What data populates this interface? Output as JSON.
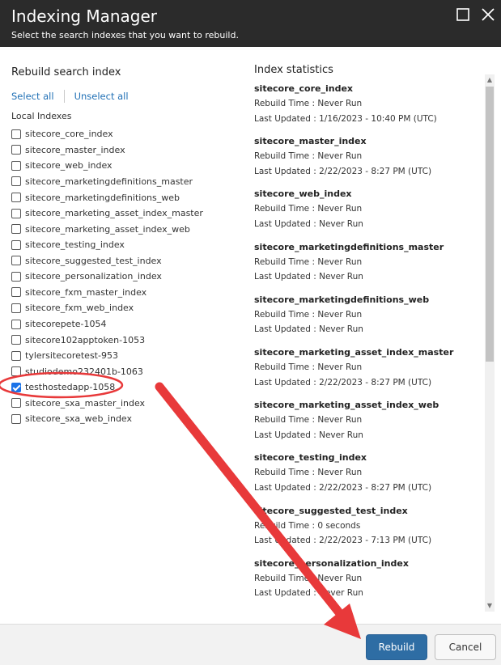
{
  "dialog": {
    "title": "Indexing Manager",
    "subtitle": "Select the search indexes that you want to rebuild."
  },
  "window_controls": {
    "maximize_icon": "maximize-icon",
    "close_icon": "close-icon"
  },
  "rebuild_panel": {
    "heading": "Rebuild search index",
    "select_all": "Select all",
    "unselect_all": "Unselect all",
    "group_label": "Local Indexes",
    "items": [
      {
        "label": "sitecore_core_index",
        "checked": false
      },
      {
        "label": "sitecore_master_index",
        "checked": false
      },
      {
        "label": "sitecore_web_index",
        "checked": false
      },
      {
        "label": "sitecore_marketingdefinitions_master",
        "checked": false
      },
      {
        "label": "sitecore_marketingdefinitions_web",
        "checked": false
      },
      {
        "label": "sitecore_marketing_asset_index_master",
        "checked": false
      },
      {
        "label": "sitecore_marketing_asset_index_web",
        "checked": false
      },
      {
        "label": "sitecore_testing_index",
        "checked": false
      },
      {
        "label": "sitecore_suggested_test_index",
        "checked": false
      },
      {
        "label": "sitecore_personalization_index",
        "checked": false
      },
      {
        "label": "sitecore_fxm_master_index",
        "checked": false
      },
      {
        "label": "sitecore_fxm_web_index",
        "checked": false
      },
      {
        "label": "sitecorepete-1054",
        "checked": false
      },
      {
        "label": "sitecore102apptoken-1053",
        "checked": false
      },
      {
        "label": "tylersitecoretest-953",
        "checked": false
      },
      {
        "label": "studiodemo232401b-1063",
        "checked": false
      },
      {
        "label": "testhostedapp-1058",
        "checked": true
      },
      {
        "label": "sitecore_sxa_master_index",
        "checked": false
      },
      {
        "label": "sitecore_sxa_web_index",
        "checked": false
      }
    ]
  },
  "stats_panel": {
    "heading": "Index statistics",
    "items": [
      {
        "name": "sitecore_core_index",
        "rebuild_time": "Rebuild Time : Never Run",
        "last_updated": "Last Updated : 1/16/2023 - 10:40 PM (UTC)"
      },
      {
        "name": "sitecore_master_index",
        "rebuild_time": "Rebuild Time : Never Run",
        "last_updated": "Last Updated : 2/22/2023 - 8:27 PM (UTC)"
      },
      {
        "name": "sitecore_web_index",
        "rebuild_time": "Rebuild Time : Never Run",
        "last_updated": "Last Updated : Never Run"
      },
      {
        "name": "sitecore_marketingdefinitions_master",
        "rebuild_time": "Rebuild Time : Never Run",
        "last_updated": "Last Updated : Never Run"
      },
      {
        "name": "sitecore_marketingdefinitions_web",
        "rebuild_time": "Rebuild Time : Never Run",
        "last_updated": "Last Updated : Never Run"
      },
      {
        "name": "sitecore_marketing_asset_index_master",
        "rebuild_time": "Rebuild Time : Never Run",
        "last_updated": "Last Updated : 2/22/2023 - 8:27 PM (UTC)"
      },
      {
        "name": "sitecore_marketing_asset_index_web",
        "rebuild_time": "Rebuild Time : Never Run",
        "last_updated": "Last Updated : Never Run"
      },
      {
        "name": "sitecore_testing_index",
        "rebuild_time": "Rebuild Time : Never Run",
        "last_updated": "Last Updated : 2/22/2023 - 8:27 PM (UTC)"
      },
      {
        "name": "sitecore_suggested_test_index",
        "rebuild_time": "Rebuild Time : 0 seconds",
        "last_updated": "Last Updated : 2/22/2023 - 7:13 PM (UTC)"
      },
      {
        "name": "sitecore_personalization_index",
        "rebuild_time": "Rebuild Time : Never Run",
        "last_updated": "Last Updated : Never Run"
      }
    ]
  },
  "footer": {
    "rebuild_label": "Rebuild",
    "cancel_label": "Cancel"
  },
  "colors": {
    "titlebar": "#2b2b2b",
    "link": "#1f6fb5",
    "primary_button": "#2e6da4",
    "annotation": "#e8393a"
  }
}
